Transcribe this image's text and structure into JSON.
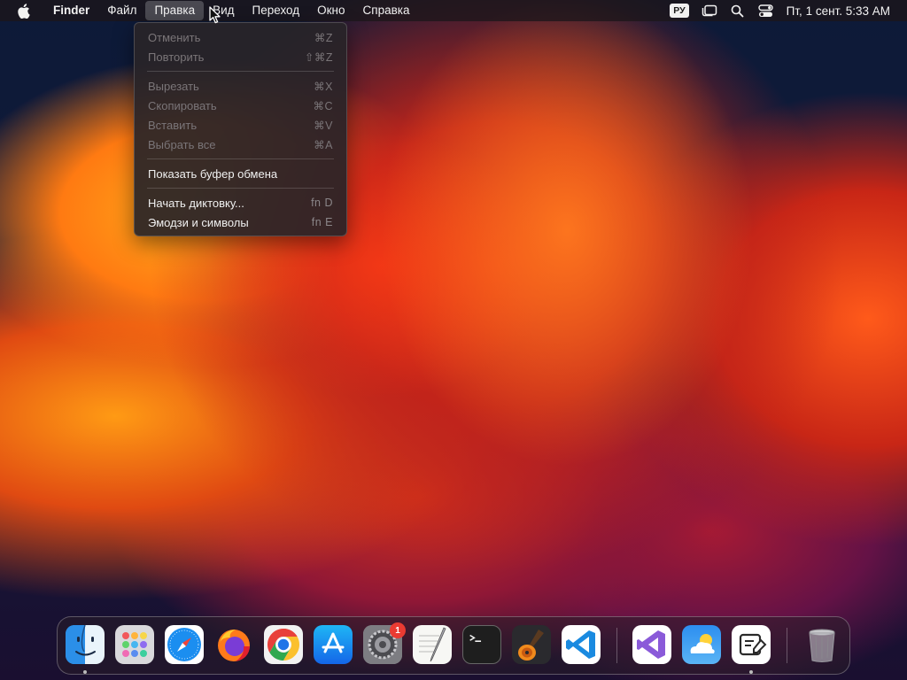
{
  "menubar": {
    "app_name": "Finder",
    "menus": [
      "Файл",
      "Правка",
      "Вид",
      "Переход",
      "Окно",
      "Справка"
    ],
    "active_menu": "Правка",
    "input_language": "РУ",
    "clock": "Пт, 1 сент.  5:33 AM"
  },
  "edit_menu": {
    "groups": [
      [
        {
          "label": "Отменить",
          "shortcut": "⌘Z",
          "enabled": false
        },
        {
          "label": "Повторить",
          "shortcut": "⇧⌘Z",
          "enabled": false
        }
      ],
      [
        {
          "label": "Вырезать",
          "shortcut": "⌘X",
          "enabled": false
        },
        {
          "label": "Скопировать",
          "shortcut": "⌘C",
          "enabled": false
        },
        {
          "label": "Вставить",
          "shortcut": "⌘V",
          "enabled": false
        },
        {
          "label": "Выбрать все",
          "shortcut": "⌘A",
          "enabled": false
        }
      ],
      [
        {
          "label": "Показать буфер обмена",
          "shortcut": "",
          "enabled": true
        }
      ],
      [
        {
          "label": "Начать диктовку...",
          "shortcut": "fn D",
          "enabled": true
        },
        {
          "label": "Эмодзи и символы",
          "shortcut": "fn E",
          "enabled": true
        }
      ]
    ]
  },
  "dock": {
    "apps": [
      {
        "icon": "finder-icon",
        "running": true
      },
      {
        "icon": "launchpad-icon",
        "running": false
      },
      {
        "icon": "safari-icon",
        "running": false
      },
      {
        "icon": "firefox-icon",
        "running": false
      },
      {
        "icon": "chrome-icon",
        "running": false
      },
      {
        "icon": "app-store-icon",
        "running": false
      },
      {
        "icon": "system-settings-icon",
        "running": false,
        "badge": "1"
      },
      {
        "icon": "textedit-icon",
        "running": false
      },
      {
        "icon": "terminal-icon",
        "running": false
      },
      {
        "icon": "garageband-icon",
        "running": false
      },
      {
        "icon": "vscode-icon",
        "running": false
      },
      {
        "icon": "visual-studio-icon",
        "running": false
      },
      {
        "icon": "weather-icon",
        "running": false
      },
      {
        "icon": "notes-editor-icon",
        "running": true
      },
      {
        "icon": "trash-icon",
        "running": false
      }
    ]
  },
  "colors": {
    "menubar_bg": "#1c161a",
    "badge": "#ea3b32",
    "dropdown_bg": "#282428"
  }
}
